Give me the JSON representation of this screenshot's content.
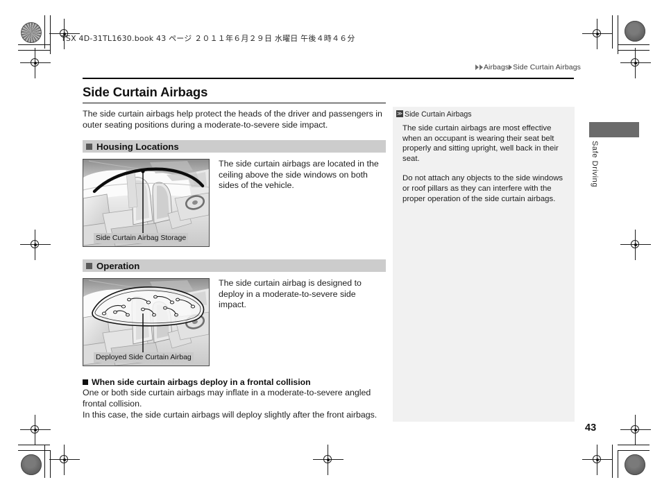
{
  "slug": {
    "text": "TSX 4D-31TL1630.book  43 ページ  ２０１１年６月２９日  水曜日  午後４時４６分"
  },
  "running_head": {
    "crumb1": "Airbags",
    "crumb2": "Side Curtain Airbags"
  },
  "main": {
    "title": "Side Curtain Airbags",
    "intro": "The side curtain airbags help protect the heads of the driver and passengers in outer seating positions during a moderate-to-severe side impact.",
    "sections": [
      {
        "heading": "Housing Locations",
        "figure_caption": "Side Curtain Airbag Storage",
        "text": "The side curtain airbags are located in the ceiling above the side windows on both sides of the vehicle."
      },
      {
        "heading": "Operation",
        "figure_caption": "Deployed Side Curtain Airbag",
        "text": "The side curtain airbag is designed to deploy in a moderate-to-severe side impact."
      }
    ],
    "subsection": {
      "heading": "When side curtain airbags deploy in a frontal collision",
      "paragraph1": "One or both side curtain airbags may inflate in a moderate-to-severe angled frontal collision.",
      "paragraph2": "In this case, the side curtain airbags will deploy slightly after the front airbags."
    }
  },
  "note_panel": {
    "badge": "≫",
    "title": "Side Curtain Airbags",
    "paragraph1": "The side curtain airbags are most effective when an occupant is wearing their seat belt properly and sitting upright, well back in their seat.",
    "paragraph2": "Do not attach any objects to the side windows or roof pillars as they can interfere with the proper operation of the side curtain airbags."
  },
  "thumb_tab": {
    "label": "Safe Driving"
  },
  "folio": {
    "page_number": "43"
  },
  "colors": {
    "section_bar": "#cccccc",
    "note_panel": "#f1f1f1",
    "thumb_tab_bar": "#6b6b6b",
    "caption_bg": "#c9c9c9"
  }
}
